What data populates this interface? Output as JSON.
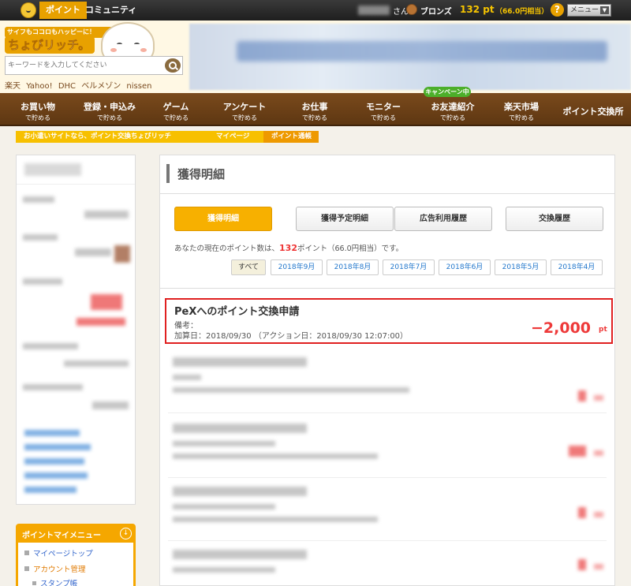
{
  "topbar": {
    "tab_point": "ポイント",
    "tab_community": "コミュニティ",
    "san": "さん",
    "rank": "ブロンズ",
    "points": "132 pt",
    "points_yen": "（66.0円相当）",
    "help": "?",
    "menu_label": "メニュー",
    "menu_arrow": "▼"
  },
  "header": {
    "logo_tagline": "サイフもココロもハッピーに！",
    "logo_main": "ちょびリッチ。",
    "search_placeholder": "キーワードを入力してください",
    "quick_links": [
      "楽天",
      "Yahoo!",
      "DHC",
      "ベルメゾン",
      "nissen"
    ]
  },
  "nav": {
    "items": [
      {
        "main": "お買い物",
        "sub": "で貯める"
      },
      {
        "main": "登録・申込み",
        "sub": "で貯める"
      },
      {
        "main": "ゲーム",
        "sub": "で貯める"
      },
      {
        "main": "アンケート",
        "sub": "で貯める"
      },
      {
        "main": "お仕事",
        "sub": "で貯める"
      },
      {
        "main": "モニター",
        "sub": "で貯める"
      },
      {
        "main": "お友達紹介",
        "sub": "で貯める"
      },
      {
        "main": "楽天市場",
        "sub": "で貯める"
      },
      {
        "main": "ポイント交換所"
      }
    ],
    "campaign_badge": "キャンペーン中"
  },
  "breadcrumb": [
    "お小遣いサイトなら、ポイント交換ちょびリッチ",
    "マイページ",
    "ポイント通帳"
  ],
  "sidebar": {
    "menu_title": "ポイントマイメニュー",
    "menu_arrow": "↓",
    "menu_items": [
      "マイページトップ",
      "アカウント管理",
      "スタンプ帳"
    ]
  },
  "main": {
    "title": "獲得明細",
    "tabs": [
      "獲得明細",
      "獲得予定明細",
      "広告利用履歴",
      "交換履歴"
    ],
    "info_prefix": "あなたの現在のポイント数は、",
    "info_points": "132",
    "info_suffix": "ポイント（66.0円相当）です。",
    "months": [
      "すべて",
      "2018年9月",
      "2018年8月",
      "2018年7月",
      "2018年6月",
      "2018年5月",
      "2018年4月"
    ],
    "entry": {
      "title": "PeXへのポイント交換申請",
      "bikou": "備考：",
      "dates": "加算日：2018/09/30 （アクション日：2018/09/30 12:07:00）",
      "points": "−2,000",
      "unit": "pt"
    }
  }
}
